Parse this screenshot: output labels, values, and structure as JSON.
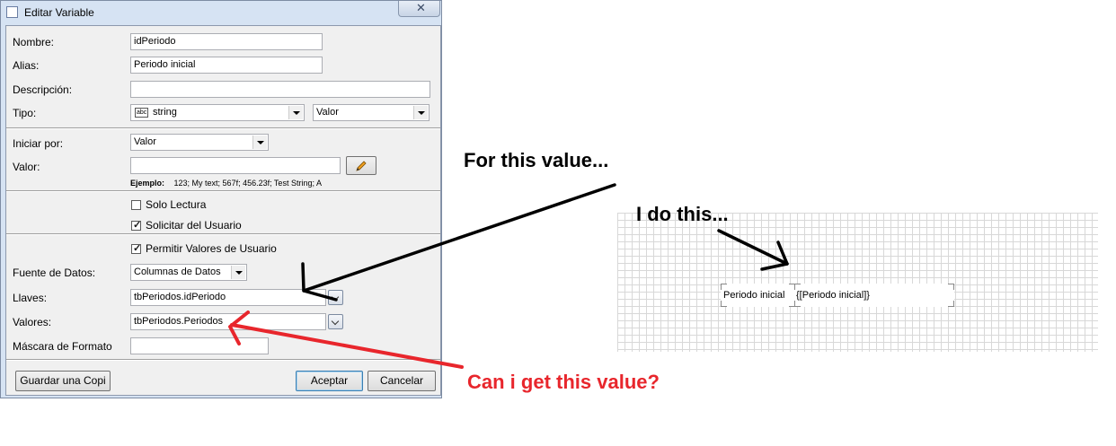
{
  "dialog": {
    "title": "Editar Variable",
    "close_glyph": "✕",
    "fields": {
      "nombre_label": "Nombre:",
      "nombre_value": "idPeriodo",
      "alias_label": "Alias:",
      "alias_value": "Periodo inicial",
      "descripcion_label": "Descripción:",
      "descripcion_value": "",
      "tipo_label": "Tipo:",
      "tipo_value": "string",
      "tipo_icon_text": "abc",
      "tipo_kind_value": "Valor",
      "iniciar_label": "Iniciar por:",
      "iniciar_value": "Valor",
      "valor_label": "Valor:",
      "valor_value": "",
      "ejemplo_label": "Ejemplo:",
      "ejemplo_text": "123; My text; 567f; 456.23f; Test String; A",
      "solo_lectura_label": "Solo Lectura",
      "solicitar_label": "Solicitar del Usuario",
      "permitir_label": "Permitir Valores de Usuario",
      "fuente_label": "Fuente de Datos:",
      "fuente_value": "Columnas de Datos",
      "llaves_label": "Llaves:",
      "llaves_value": "tbPeriodos.idPeriodo",
      "valores_label": "Valores:",
      "valores_value": "tbPeriodos.Periodos",
      "mascara_label": "Máscara de Formato",
      "mascara_value": ""
    },
    "checkboxes": {
      "solo_lectura": false,
      "solicitar": true,
      "permitir": true
    },
    "buttons": {
      "guardar": "Guardar una Copi",
      "aceptar": "Aceptar",
      "cancelar": "Cancelar"
    }
  },
  "designer": {
    "label_text": "Periodo inicial",
    "expression_text": "{[Periodo inicial]}"
  },
  "annotations": {
    "for_this_value": "For this value...",
    "i_do_this": "I do this...",
    "can_i_get": "Can i get this value?",
    "colors": {
      "black": "#000000",
      "red": "#e8262c"
    }
  }
}
